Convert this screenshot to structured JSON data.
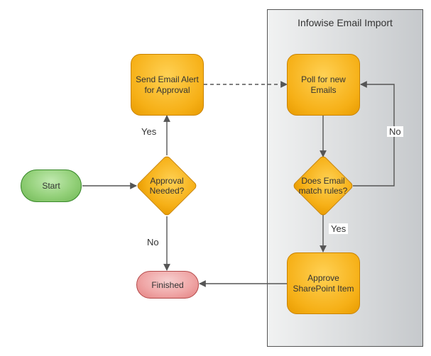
{
  "panel": {
    "title": "Infowise Email Import"
  },
  "nodes": {
    "start": "Start",
    "approval_needed": "Approval Needed?",
    "send_alert": "Send Email Alert for Approval",
    "poll": "Poll for new Emails",
    "match_rules": "Does Email match rules?",
    "approve_item": "Approve SharePoint Item",
    "finished": "Finished"
  },
  "edge_labels": {
    "approval_yes": "Yes",
    "approval_no": "No",
    "match_yes": "Yes",
    "match_no": "No"
  },
  "chart_data": {
    "type": "flowchart",
    "swimlanes": [
      {
        "id": "main",
        "label": ""
      },
      {
        "id": "infowise",
        "label": "Infowise Email Import"
      }
    ],
    "nodes": [
      {
        "id": "start",
        "label": "Start",
        "shape": "terminator",
        "lane": "main"
      },
      {
        "id": "approval_needed",
        "label": "Approval Needed?",
        "shape": "decision",
        "lane": "main"
      },
      {
        "id": "send_alert",
        "label": "Send Email Alert for Approval",
        "shape": "process",
        "lane": "main"
      },
      {
        "id": "finished",
        "label": "Finished",
        "shape": "terminator",
        "lane": "main"
      },
      {
        "id": "poll",
        "label": "Poll for new Emails",
        "shape": "process",
        "lane": "infowise"
      },
      {
        "id": "match_rules",
        "label": "Does Email match rules?",
        "shape": "decision",
        "lane": "infowise"
      },
      {
        "id": "approve_item",
        "label": "Approve SharePoint Item",
        "shape": "process",
        "lane": "infowise"
      }
    ],
    "edges": [
      {
        "from": "start",
        "to": "approval_needed",
        "label": "",
        "style": "solid"
      },
      {
        "from": "approval_needed",
        "to": "send_alert",
        "label": "Yes",
        "style": "solid"
      },
      {
        "from": "approval_needed",
        "to": "finished",
        "label": "No",
        "style": "solid"
      },
      {
        "from": "send_alert",
        "to": "poll",
        "label": "",
        "style": "dashed"
      },
      {
        "from": "poll",
        "to": "match_rules",
        "label": "",
        "style": "solid"
      },
      {
        "from": "match_rules",
        "to": "poll",
        "label": "No",
        "style": "solid"
      },
      {
        "from": "match_rules",
        "to": "approve_item",
        "label": "Yes",
        "style": "solid"
      },
      {
        "from": "approve_item",
        "to": "finished",
        "label": "",
        "style": "solid"
      }
    ]
  }
}
